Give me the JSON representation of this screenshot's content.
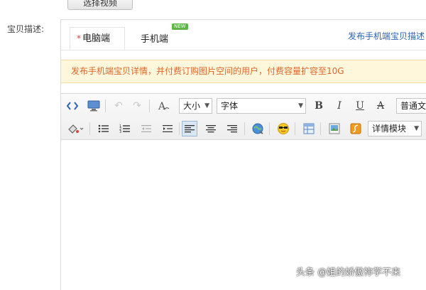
{
  "top_button": {
    "label": "选择视频"
  },
  "field": {
    "label": "宝贝描述:"
  },
  "tabs": {
    "pc": {
      "required_mark": "*",
      "label": "电脑端"
    },
    "mobile": {
      "label": "手机端",
      "badge": "NEW"
    },
    "publish_link": "发布手机端宝贝描述"
  },
  "notice": {
    "text": "发布手机端宝贝详情，并付费订购图片空间的用户，付费容量扩容至10G"
  },
  "toolbar": {
    "font_size": "大小",
    "font_family": "字体",
    "format": "普通文",
    "detail_module": "详情模块"
  },
  "colors": {
    "accent": "#2d64b3",
    "notice_text": "#e0672a",
    "notice_bg": "#fff7dc"
  },
  "watermark": "头条 @姐的娇傲祢学不来"
}
